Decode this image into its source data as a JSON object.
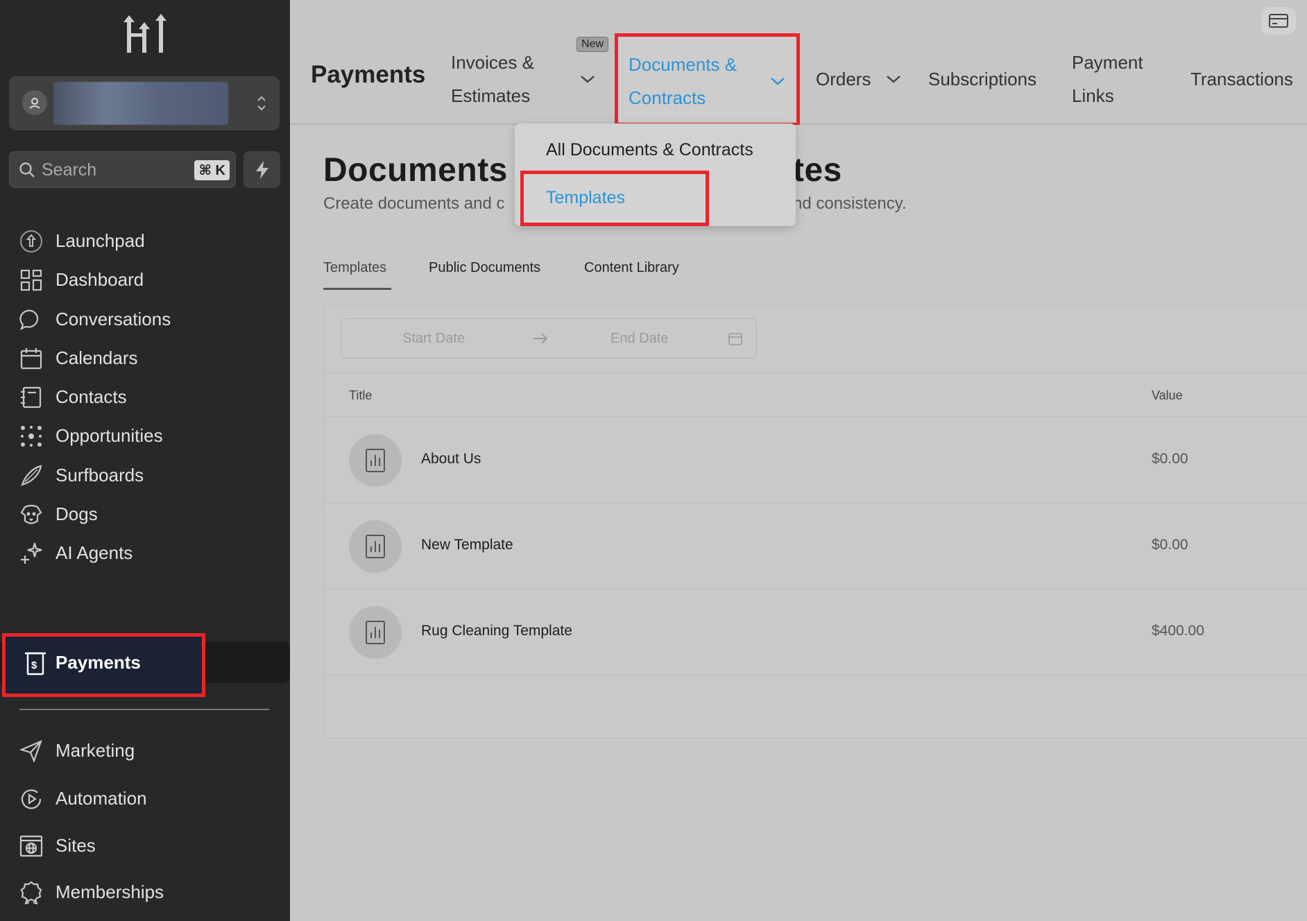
{
  "sidebar": {
    "search_placeholder": "Search",
    "search_shortcut": "⌘ K",
    "items": [
      {
        "label": "Launchpad",
        "icon": "launchpad-icon"
      },
      {
        "label": "Dashboard",
        "icon": "dashboard-icon"
      },
      {
        "label": "Conversations",
        "icon": "chat-bubble-icon"
      },
      {
        "label": "Calendars",
        "icon": "calendar-icon"
      },
      {
        "label": "Contacts",
        "icon": "contacts-book-icon"
      },
      {
        "label": "Opportunities",
        "icon": "opportunities-icon"
      },
      {
        "label": "Surfboards",
        "icon": "surfboard-icon"
      },
      {
        "label": "Dogs",
        "icon": "dog-icon"
      },
      {
        "label": "AI Agents",
        "icon": "sparkle-icon"
      },
      {
        "label": "Payments",
        "icon": "payments-receipt-icon",
        "active": true
      },
      {
        "label": "Marketing",
        "icon": "send-icon"
      },
      {
        "label": "Automation",
        "icon": "automation-icon"
      },
      {
        "label": "Sites",
        "icon": "globe-window-icon"
      },
      {
        "label": "Memberships",
        "icon": "award-icon"
      }
    ]
  },
  "topbar": {
    "title": "Payments",
    "invoices_line1": "Invoices &",
    "invoices_line2": "Estimates",
    "new_badge": "New",
    "docs_line1": "Documents &",
    "docs_line2": "Contracts",
    "orders": "Orders",
    "subscriptions": "Subscriptions",
    "payment_links_line1": "Payment",
    "payment_links_line2": "Links",
    "transactions": "Transactions"
  },
  "dropdown": {
    "items": [
      "All Documents & Contracts",
      "Templates"
    ]
  },
  "main": {
    "title_left": "Documents &",
    "title_right": "tes",
    "subtitle_left": "Create documents and c",
    "subtitle_right": "nd consistency.",
    "tabs": [
      "Templates",
      "Public Documents",
      "Content Library"
    ],
    "date_start_placeholder": "Start Date",
    "date_end_placeholder": "End Date",
    "columns": {
      "title": "Title",
      "value": "Value"
    },
    "rows": [
      {
        "title": "About Us",
        "value": "$0.00"
      },
      {
        "title": "New Template",
        "value": "$0.00"
      },
      {
        "title": "Rug Cleaning Template",
        "value": "$400.00"
      }
    ]
  },
  "colors": {
    "sidebar_bg": "#282828",
    "highlight_red": "#e8262b",
    "accent_blue": "#2c93d6",
    "main_bg": "#c8c8c8"
  }
}
